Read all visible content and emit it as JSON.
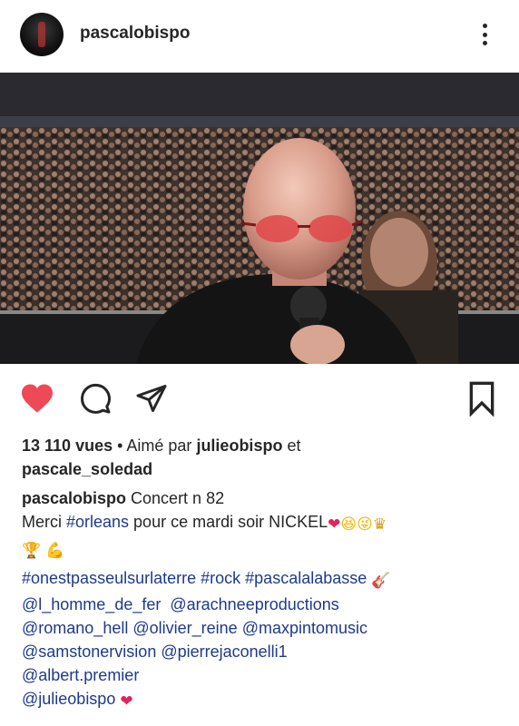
{
  "header": {
    "username": "pascalobispo"
  },
  "post": {
    "image_description_icon": "concert-selfie-image",
    "liked": true
  },
  "stats": {
    "views": "13 110 vues",
    "separator": " • Aimé par ",
    "liked_by_1": "julieobispo",
    "and": " et",
    "liked_by_2": "pascale_soledad"
  },
  "caption": {
    "author": "pascalobispo",
    "line1_text": " Concert n 82",
    "merci": "Merci ",
    "orleans": "#orleans",
    "line2_rest": "  pour ce mardi soir NICKEL",
    "hashtags_1": "#onestpasseulsurlaterre",
    "hashtags_2": " #rock",
    "hashtags_3": " #pascalalabasse",
    "mentions": [
      "@l_homme_de_fer",
      "@arachneeproductions",
      "@romano_hell",
      "@olivier_reine",
      "@maxpintomusic",
      "@samstonervision",
      "@pierrejaconelli1",
      "@albert.premier",
      "@julieobispo"
    ]
  },
  "icons": {
    "heart": "heart-icon",
    "comment": "comment-icon",
    "share": "share-icon",
    "save": "bookmark-icon",
    "more": "more-options-icon"
  },
  "colors": {
    "like_red": "#ed4956",
    "link_blue": "#1e3a8a",
    "text": "#262626"
  }
}
